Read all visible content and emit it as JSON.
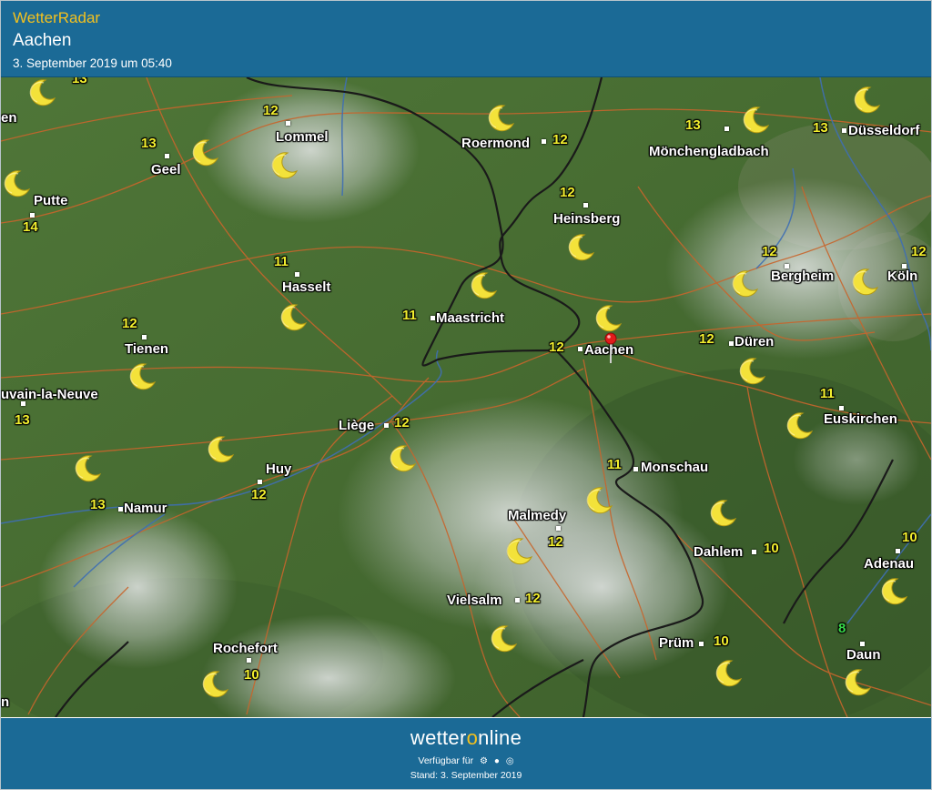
{
  "header": {
    "app_name": "WetterRadar",
    "location": "Aachen",
    "timestamp": "3. September 2019 um 05:40"
  },
  "colors": {
    "header_bg": "#1b6a96",
    "brand_yellow": "#f3c11e",
    "temp_yellow": "#f2ef2e",
    "temp_green": "#38d94a",
    "map_green": "#4a6f35",
    "road": "#c8652c",
    "border": "#1a1a1a",
    "river": "#3f6fb3"
  },
  "map": {
    "cities": [
      {
        "id": "lommel",
        "name": "Lommel",
        "temp": "12"
      },
      {
        "id": "geel",
        "name": "Geel",
        "temp": "13"
      },
      {
        "id": "putte",
        "name": "Putte",
        "temp": "14"
      },
      {
        "id": "roermond",
        "name": "Roermond",
        "temp": "12"
      },
      {
        "id": "moenchengladbach",
        "name": "Mönchengladbach",
        "temp": "13"
      },
      {
        "id": "duesseldorf",
        "name": "Düsseldorf",
        "temp": "13"
      },
      {
        "id": "heinsberg",
        "name": "Heinsberg",
        "temp": "12"
      },
      {
        "id": "hasselt",
        "name": "Hasselt",
        "temp": "11"
      },
      {
        "id": "maastricht",
        "name": "Maastricht",
        "temp": "11"
      },
      {
        "id": "bergheim",
        "name": "Bergheim",
        "temp": "12"
      },
      {
        "id": "koeln",
        "name": "Köln",
        "temp": "12"
      },
      {
        "id": "tienen",
        "name": "Tienen",
        "temp": "12"
      },
      {
        "id": "aachen",
        "name": "Aachen",
        "temp": "12"
      },
      {
        "id": "dueren",
        "name": "Düren",
        "temp": "12"
      },
      {
        "id": "louvain",
        "name": "uvain-la-Neuve",
        "temp": "13"
      },
      {
        "id": "euskirchen",
        "name": "Euskirchen",
        "temp": "11"
      },
      {
        "id": "liege",
        "name": "Liège",
        "temp": "12"
      },
      {
        "id": "huy",
        "name": "Huy",
        "temp": "12"
      },
      {
        "id": "monschau",
        "name": "Monschau",
        "temp": "11"
      },
      {
        "id": "namur",
        "name": "Namur",
        "temp": "13"
      },
      {
        "id": "malmedy",
        "name": "Malmedy",
        "temp": "12"
      },
      {
        "id": "dahlem",
        "name": "Dahlem",
        "temp": "10"
      },
      {
        "id": "adenau",
        "name": "Adenau",
        "temp": "10"
      },
      {
        "id": "vielsalm",
        "name": "Vielsalm",
        "temp": "12"
      },
      {
        "id": "pruem",
        "name": "Prüm",
        "temp": "10"
      },
      {
        "id": "rochefort",
        "name": "Rochefort",
        "temp": "10"
      },
      {
        "id": "daun",
        "name": "Daun",
        "temp": "8"
      }
    ],
    "edge_labels": {
      "west_en": "en",
      "top_13": "13",
      "bottom_left": "n"
    },
    "icon": "moon-crescent-icon",
    "pin_icon": "location-pin-icon"
  },
  "footer": {
    "brand_pre": "wetter",
    "brand_o": "o",
    "brand_post": "nline",
    "available": "Verfügbar für",
    "platform_icons": [
      "android-icon",
      "apple-icon",
      "web-icon"
    ],
    "status": "Stand: 3. September 2019"
  }
}
